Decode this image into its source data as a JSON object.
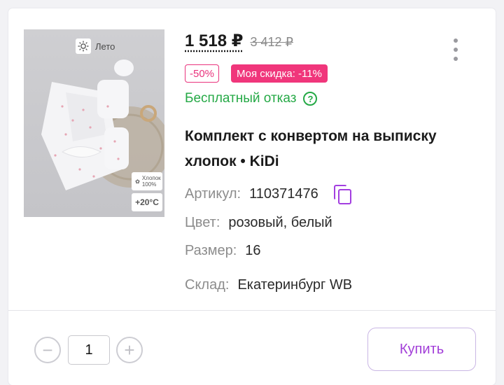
{
  "product": {
    "image": {
      "season_badge": "Лето",
      "cotton_badge": "Хлопок 100%",
      "temperature_badge": "+20°C"
    },
    "price": "1 518 ₽",
    "old_price": "3 412 ₽",
    "discount_badge": "-50%",
    "my_discount_badge": "Моя скидка: -11%",
    "free_refusal": "Бесплатный отказ",
    "title": "Комплект с конвертом на выписку хлопок • KiDi",
    "article": {
      "label": "Артикул:",
      "value": "110371476"
    },
    "color": {
      "label": "Цвет:",
      "value": "розовый, белый"
    },
    "size": {
      "label": "Размер:",
      "value": "16"
    },
    "warehouse": {
      "label": "Склад:",
      "value": "Екатеринбург WB"
    }
  },
  "cart": {
    "quantity": "1",
    "minus_symbol": "−",
    "plus_symbol": "+",
    "buy_label": "Купить"
  },
  "colors": {
    "accent_purple": "#a23ed8",
    "discount_pink": "#f0367b",
    "success_green": "#25a946"
  },
  "icons": [
    "sun-icon",
    "cotton-icon",
    "kebab-menu-icon",
    "help-icon",
    "copy-icon",
    "minus-icon",
    "plus-icon"
  ]
}
